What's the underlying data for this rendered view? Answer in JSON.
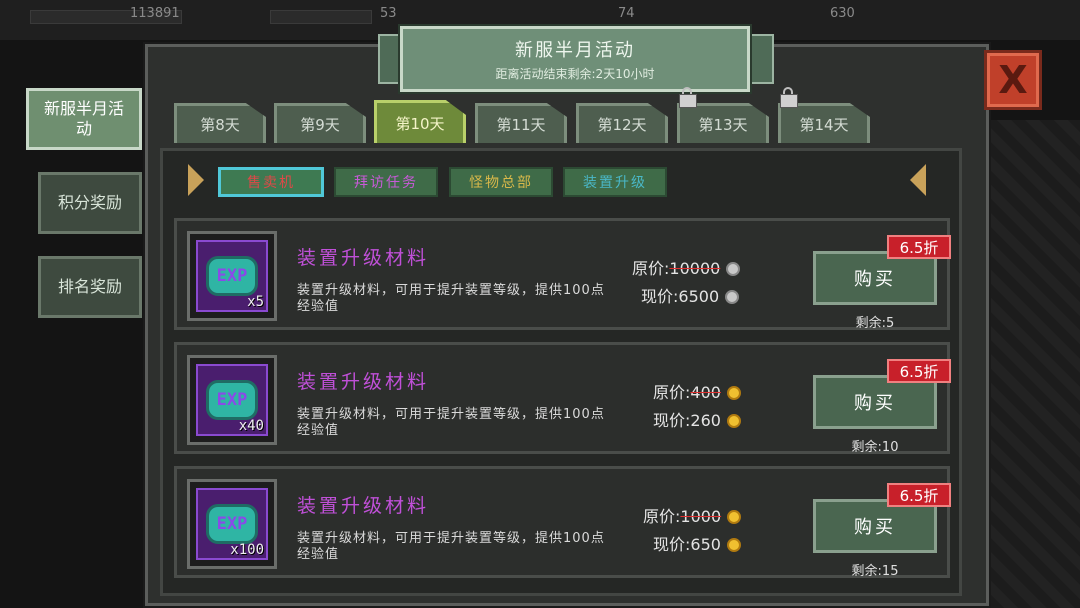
{
  "background": {
    "hud_values": [
      "113891",
      "53",
      "74",
      "630"
    ]
  },
  "header": {
    "title": "新服半月活动",
    "subtitle": "距离活动结束剩余:2天10小时"
  },
  "side_tabs": [
    {
      "label": "新服半月活动",
      "active": true
    },
    {
      "label": "积分奖励",
      "active": false
    },
    {
      "label": "排名奖励",
      "active": false
    }
  ],
  "day_tabs": [
    {
      "label": "第8天",
      "active": false,
      "locked": false
    },
    {
      "label": "第9天",
      "active": false,
      "locked": false
    },
    {
      "label": "第10天",
      "active": true,
      "locked": false
    },
    {
      "label": "第11天",
      "active": false,
      "locked": false
    },
    {
      "label": "第12天",
      "active": false,
      "locked": false
    },
    {
      "label": "第13天",
      "active": false,
      "locked": true
    },
    {
      "label": "第14天",
      "active": false,
      "locked": true
    }
  ],
  "categories": [
    {
      "label": "售卖机",
      "active": true,
      "color": "#e04848"
    },
    {
      "label": "拜访任务",
      "active": false,
      "color": "#c85ad8"
    },
    {
      "label": "怪物总部",
      "active": false,
      "color": "#d8b84a"
    },
    {
      "label": "装置升级",
      "active": false,
      "color": "#4ab8c8"
    }
  ],
  "shop": {
    "original_label": "原价:",
    "current_label": "现价:",
    "buy_label": "购买",
    "remain_label": "剩余:",
    "items": [
      {
        "icon_text": "EXP",
        "qty": "x5",
        "name": "装置升级材料",
        "desc": "装置升级材料，可用于提升装置等级，提供100点经验值",
        "original_price": "10000",
        "price": "6500",
        "currency": "silver",
        "discount": "6.5折",
        "remain": "5"
      },
      {
        "icon_text": "EXP",
        "qty": "x40",
        "name": "装置升级材料",
        "desc": "装置升级材料，可用于提升装置等级，提供100点经验值",
        "original_price": "400",
        "price": "260",
        "currency": "gold",
        "discount": "6.5折",
        "remain": "10"
      },
      {
        "icon_text": "EXP",
        "qty": "x100",
        "name": "装置升级材料",
        "desc": "装置升级材料，可用于提升装置等级，提供100点经验值",
        "original_price": "1000",
        "price": "650",
        "currency": "gold",
        "discount": "6.5折",
        "remain": "15"
      }
    ]
  },
  "close_label": "X"
}
